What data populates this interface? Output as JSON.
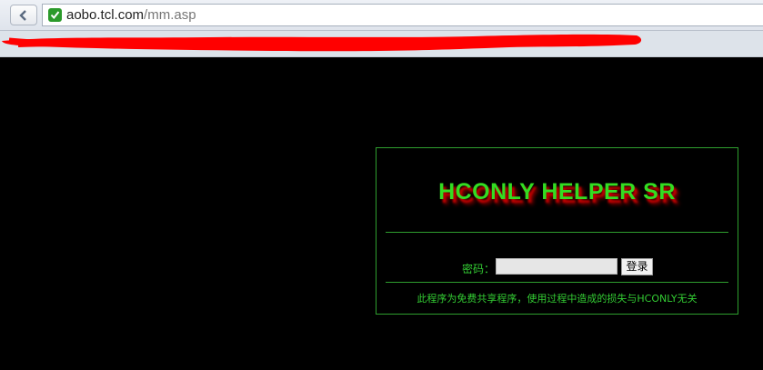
{
  "browser": {
    "url_host": "aobo.tcl.com",
    "url_path": "/mm.asp",
    "back_icon": "chevron-left-icon",
    "secure_icon": "check-icon",
    "secure_color": "#2b9a2b"
  },
  "page": {
    "background": "#000000",
    "title": "HCONLY HELPER SR",
    "title_color": "#33dd22",
    "title_shadow_color": "#c00000",
    "password_label": "密码：",
    "password_value": "",
    "login_button_label": "登录",
    "disclaimer": "此程序为免费共享程序，使用过程中造成的损失与HCONLY无关",
    "accent_color": "#33cc33"
  },
  "redaction_color": "#ff0000"
}
